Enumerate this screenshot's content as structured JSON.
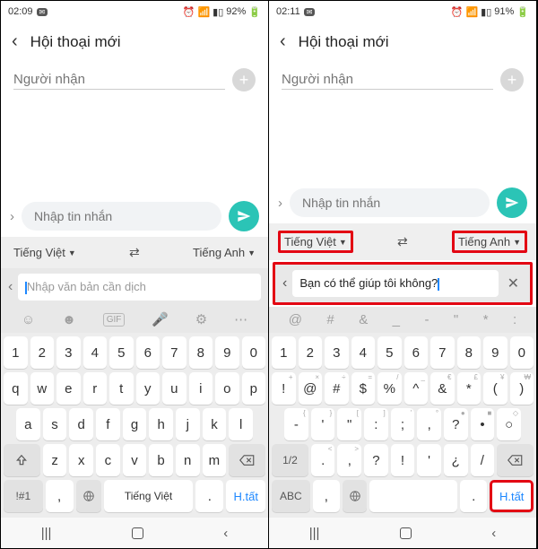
{
  "left": {
    "status": {
      "time": "02:09",
      "battery": "92%"
    },
    "header": {
      "title": "Hội thoại mới"
    },
    "recipient_placeholder": "Người nhận",
    "compose_placeholder": "Nhập tin nhắn",
    "ime": {
      "src_lang": "Tiếng Việt",
      "dst_lang": "Tiếng Anh",
      "translate_placeholder": "Nhập văn bản cần dịch"
    },
    "kb": {
      "row1": [
        "1",
        "2",
        "3",
        "4",
        "5",
        "6",
        "7",
        "8",
        "9",
        "0"
      ],
      "row2": [
        "q",
        "w",
        "e",
        "r",
        "t",
        "y",
        "u",
        "i",
        "o",
        "p"
      ],
      "row3": [
        "a",
        "s",
        "d",
        "f",
        "g",
        "h",
        "j",
        "k",
        "l"
      ],
      "row4_mid": [
        "z",
        "x",
        "c",
        "v",
        "b",
        "n",
        "m"
      ],
      "sym": "!#1",
      "comma": ",",
      "space": "Tiếng Việt",
      "period": ".",
      "done": "H.tất"
    }
  },
  "right": {
    "status": {
      "time": "02:11",
      "battery": "91%"
    },
    "header": {
      "title": "Hội thoại mới"
    },
    "recipient_placeholder": "Người nhận",
    "compose_placeholder": "Nhập tin nhắn",
    "ime": {
      "src_lang": "Tiếng Việt",
      "dst_lang": "Tiếng Anh",
      "translate_value": "Bạn có thể giúp tôi không?"
    },
    "toolbar": [
      "@",
      "#",
      "&",
      "_",
      "-",
      "\"",
      "*",
      ":"
    ],
    "kb": {
      "row1": [
        "1",
        "2",
        "3",
        "4",
        "5",
        "6",
        "7",
        "8",
        "9",
        "0"
      ],
      "row2alt": [
        "+",
        "×",
        "÷",
        "=",
        "/",
        "_",
        "€",
        "£",
        "¥",
        "₩"
      ],
      "row2": [
        "!",
        "@",
        "#",
        "$",
        "%",
        "^",
        "&",
        "*",
        "(",
        ")"
      ],
      "row3alt": [
        "{",
        "}",
        "[",
        "]",
        "'",
        "°",
        "●",
        "■",
        "◇"
      ],
      "row3": [
        "-",
        "'",
        "\"",
        ":",
        ";",
        ",",
        "?",
        "•",
        "○"
      ],
      "row4_mid_alt": [
        "<",
        ">",
        "",
        "",
        "",
        "",
        ""
      ],
      "row4_mid": [
        ".",
        ",",
        "?",
        "!",
        "'",
        "¿",
        "/"
      ],
      "frac": "1/2",
      "abc": "ABC",
      "comma": ",",
      "space": "",
      "period": ".",
      "done": "H.tất"
    }
  }
}
